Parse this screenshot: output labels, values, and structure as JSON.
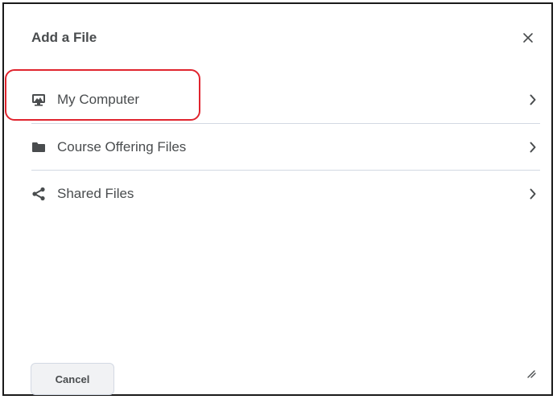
{
  "dialog": {
    "title": "Add a File",
    "close_icon": "close-icon"
  },
  "sources": [
    {
      "label": "My Computer",
      "icon": "computer-icon",
      "highlighted": true
    },
    {
      "label": "Course Offering Files",
      "icon": "folder-icon"
    },
    {
      "label": "Shared Files",
      "icon": "share-icon"
    }
  ],
  "footer": {
    "cancel_label": "Cancel"
  },
  "colors": {
    "text": "#494c4e",
    "divider": "#d3d9e3",
    "highlight": "#e0242e",
    "button_bg": "#f1f2f4"
  }
}
